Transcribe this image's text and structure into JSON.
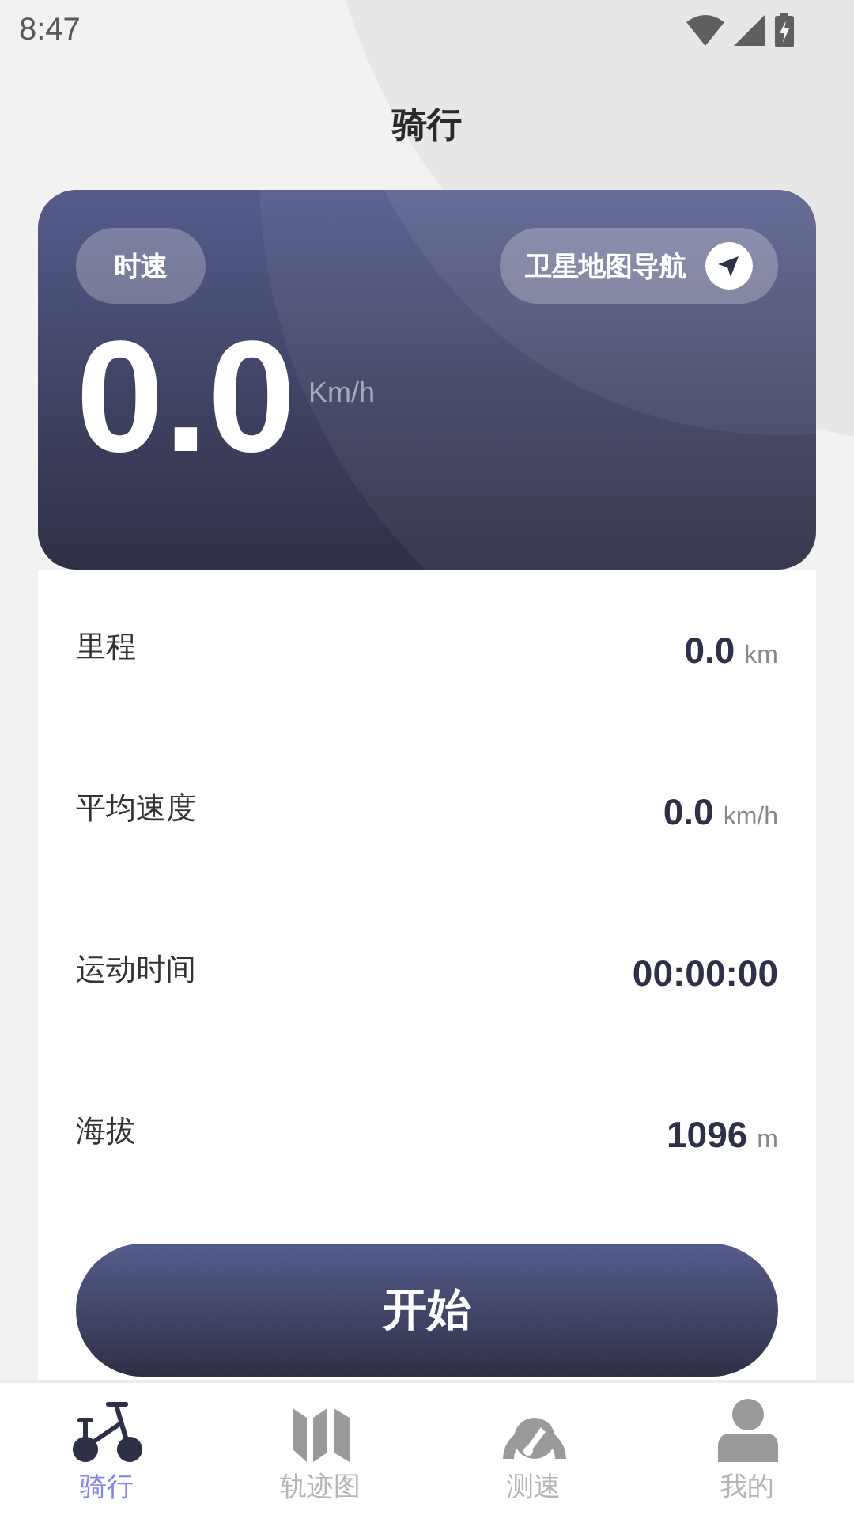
{
  "status_bar": {
    "time": "8:47"
  },
  "title": "骑行",
  "speed_card": {
    "mode_label": "时速",
    "nav_button": "卫星地图导航",
    "speed": "0.0",
    "unit": "Km/h"
  },
  "stats": [
    {
      "label": "里程",
      "value": "0.0",
      "unit": "km"
    },
    {
      "label": "平均速度",
      "value": "0.0",
      "unit": "km/h"
    },
    {
      "label": "运动时间",
      "value": "00:00:00"
    },
    {
      "label": "海拔",
      "value": "1096",
      "unit": "m"
    }
  ],
  "start_button": "开始",
  "tabs": [
    {
      "label": "骑行",
      "kind": "bike",
      "selected": true
    },
    {
      "label": "轨迹图",
      "kind": "map",
      "selected": false
    },
    {
      "label": "测速",
      "kind": "gauge",
      "selected": false
    },
    {
      "label": "我的",
      "kind": "person",
      "selected": false
    }
  ]
}
